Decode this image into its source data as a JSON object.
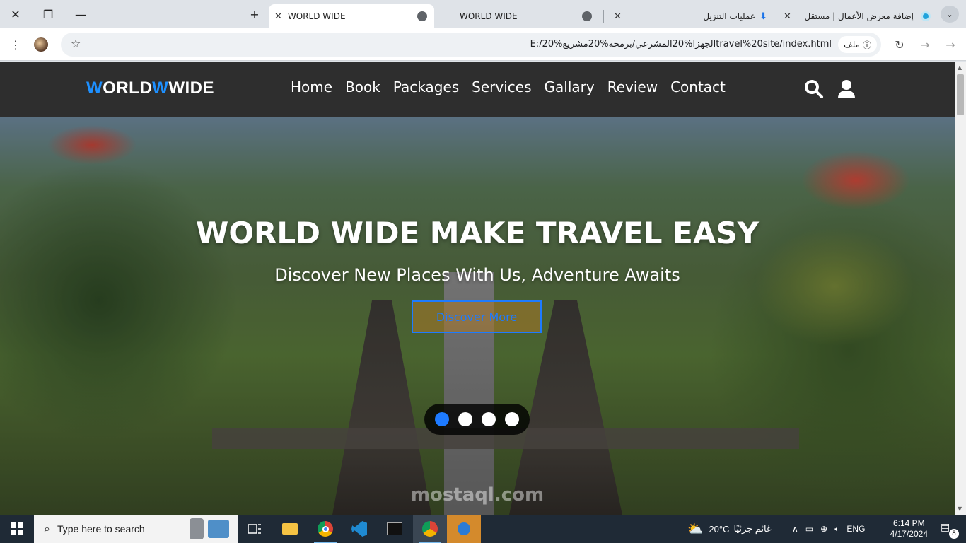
{
  "browser": {
    "tabs": [
      {
        "title": "WORLD WIDE",
        "active": true
      },
      {
        "title": "WORLD WIDE",
        "active": false
      },
      {
        "title": "عمليات التنزيل",
        "active": false
      },
      {
        "title": "إضافة معرض الأعمال | مستقل",
        "active": false
      }
    ],
    "new_tab": "+",
    "address": {
      "url": "E:/الجهزا%20المشرعي/برمحه%20مشريع%20travel%20site/index.html",
      "chip_label": "ملف"
    }
  },
  "site": {
    "logo": {
      "part1_a": "W",
      "part1_b": "ORLD",
      "part2_a": "W",
      "part2_b": "WIDE"
    },
    "nav": [
      "Home",
      "Book",
      "Packages",
      "Services",
      "Gallary",
      "Review",
      "Contact"
    ],
    "hero": {
      "title": "WORLD WIDE MAKE TRAVEL EASY",
      "subtitle": "Discover New Places With Us, Adventure Awaits",
      "button": "Discover More"
    },
    "slider": {
      "count": 4,
      "active_index": 0
    },
    "watermark": "mostaql.com",
    "colors": {
      "accent": "#1e90ff",
      "navbar": "#2e2e2e"
    }
  },
  "taskbar": {
    "search_placeholder": "Type here to search",
    "weather": {
      "temp": "20°C",
      "desc": "غائم جزئيًا"
    },
    "language": "ENG",
    "time": "6:14 PM",
    "date": "4/17/2024",
    "notifications": "8"
  }
}
